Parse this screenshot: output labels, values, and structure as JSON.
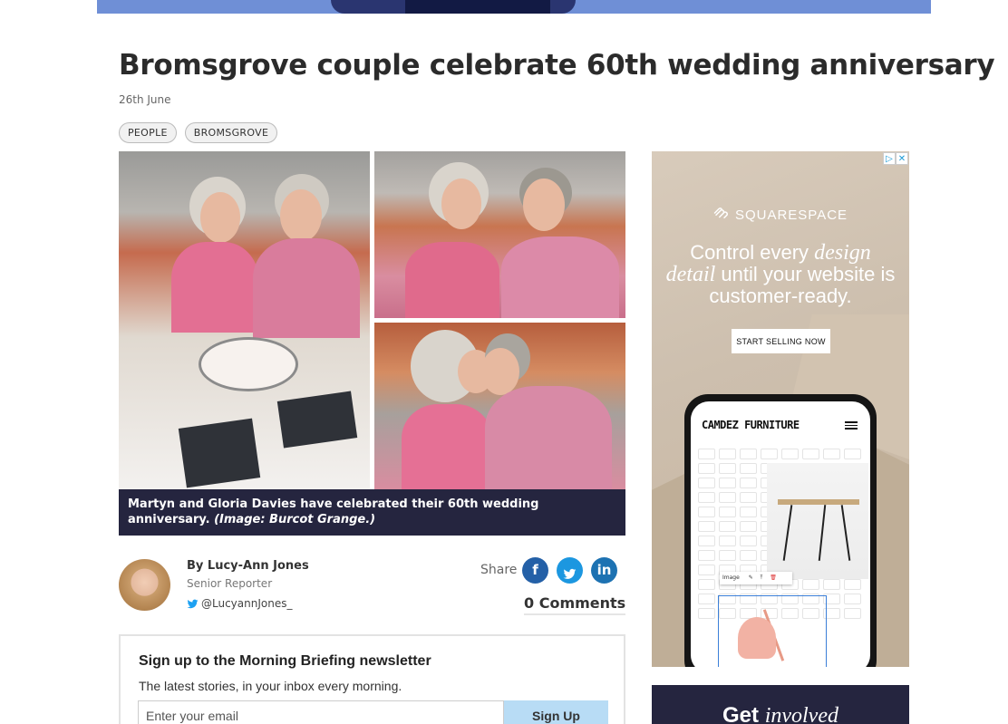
{
  "article": {
    "headline": "Bromsgrove couple celebrate 60th wedding anniversary",
    "date": "26th June",
    "tags": [
      "PEOPLE",
      "BROMSGROVE"
    ],
    "caption": "Martyn and Gloria Davies have celebrated their 60th wedding anniversary. ",
    "caption_credit": "(Image: Burcot Grange.)"
  },
  "author": {
    "name": "By Lucy-Ann Jones",
    "role": "Senior Reporter",
    "twitter": "@LucyannJones_"
  },
  "share": {
    "label": "Share",
    "facebook_glyph": "f",
    "twitter_glyph": "🐦",
    "linkedin_glyph": "in",
    "comments": "0 Comments"
  },
  "newsletter": {
    "title": "Sign up to the Morning Briefing newsletter",
    "subtitle": "The latest stories, in your inbox every morning.",
    "email_placeholder": "Enter your email",
    "button": "Sign Up"
  },
  "ad": {
    "brand": "SQUARESPACE",
    "headline_pre": "Control every ",
    "headline_em1": "design",
    "headline_em2": "detail",
    "headline_post": " until your website is customer-ready.",
    "cta": "START SELLING NOW",
    "phone_title": "CAMDEZ FURNITURE",
    "toolbar_label": "Image",
    "choice_play": "▷",
    "choice_close": "✕"
  },
  "promo": {
    "text": "Get ",
    "em": "involved"
  },
  "colors": {
    "caption_bg": "#25253f",
    "facebook": "#2460a7",
    "twitter": "#1c97e0",
    "linkedin": "#1d72b2",
    "signup_button": "#b8dcf5"
  }
}
